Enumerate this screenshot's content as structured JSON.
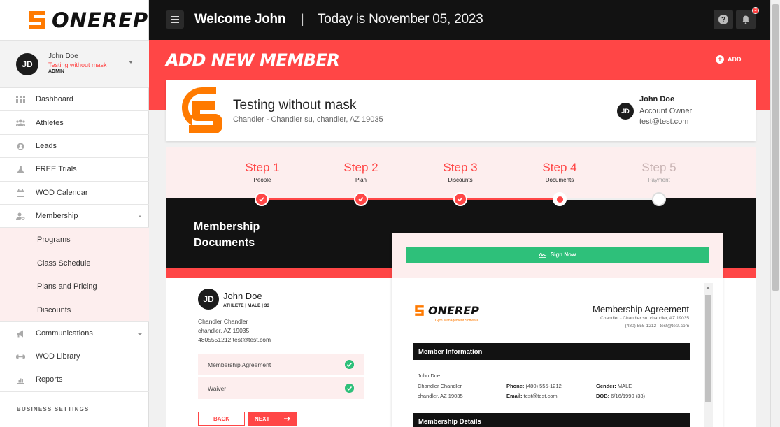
{
  "app": {
    "brand": "ONEREP"
  },
  "user": {
    "initials": "JD",
    "name": "John Doe",
    "gym": "Testing without mask",
    "role": "ADMIN"
  },
  "nav": {
    "items": [
      {
        "label": "Dashboard",
        "icon": "grid-icon"
      },
      {
        "label": "Athletes",
        "icon": "people-icon"
      },
      {
        "label": "Leads",
        "icon": "user-circle-icon"
      },
      {
        "label": "FREE Trials",
        "icon": "flask-icon"
      },
      {
        "label": "WOD Calendar",
        "icon": "calendar-icon"
      },
      {
        "label": "Membership",
        "icon": "user-gear-icon"
      }
    ],
    "sub": [
      {
        "label": "Programs"
      },
      {
        "label": "Class Schedule"
      },
      {
        "label": "Plans and Pricing"
      },
      {
        "label": "Discounts"
      }
    ],
    "items2": [
      {
        "label": "Communications",
        "icon": "megaphone-icon"
      },
      {
        "label": "WOD Library",
        "icon": "dumbbell-icon"
      },
      {
        "label": "Reports",
        "icon": "report-icon"
      }
    ],
    "section": "BUSINESS SETTINGS"
  },
  "topbar": {
    "welcome": "Welcome John",
    "separator": "|",
    "today": "Today is November 05, 2023",
    "notifications": "2"
  },
  "page": {
    "title": "ADD NEW MEMBER",
    "add_label": "ADD"
  },
  "gym": {
    "name": "Testing without mask",
    "address": "Chandler - Chandler su, chandler, AZ 19035",
    "owner_initials": "JD",
    "owner_name": "John Doe",
    "owner_role": "Account Owner",
    "owner_email": "test@test.com"
  },
  "steps": [
    {
      "title": "Step 1",
      "sub": "People",
      "state": "done"
    },
    {
      "title": "Step 2",
      "sub": "Plan",
      "state": "done"
    },
    {
      "title": "Step 3",
      "sub": "Discounts",
      "state": "done"
    },
    {
      "title": "Step 4",
      "sub": "Documents",
      "state": "current"
    },
    {
      "title": "Step 5",
      "sub": "Payment",
      "state": "pending"
    }
  ],
  "docs": {
    "title_line1": "Membership",
    "title_line2": "Documents"
  },
  "member": {
    "initials": "JD",
    "name": "John Doe",
    "meta": "ATHLETE | MALE | 33",
    "address1": "Chandler Chandler",
    "address2": "chandler, AZ 19035",
    "contact": "4805551212 test@test.com"
  },
  "documents": [
    {
      "label": "Membership Agreement",
      "status": "signed"
    },
    {
      "label": "Waiver",
      "status": "signed"
    }
  ],
  "buttons": {
    "back": "BACK",
    "next": "NEXT"
  },
  "preview": {
    "sign_label": "Sign Now",
    "logo": "ONEREP",
    "tagline": "Gym Management Software",
    "title": "Membership Agreement",
    "gym_line": "Chandler - Chandler su, chandler, AZ 19035",
    "contact_line": "(480) 555-1212 | test@test.com",
    "section1": "Member Information",
    "member_name": "John Doe",
    "member_addr1": "Chandler Chandler",
    "member_addr2": "chandler, AZ 19035",
    "phone_label": "Phone:",
    "phone": "(480) 555-1212",
    "email_label": "Email:",
    "email": "test@test.com",
    "gender_label": "Gender:",
    "gender": "MALE",
    "dob_label": "DOB:",
    "dob": "6/16/1990 (33)",
    "section2": "Membership Details"
  },
  "colors": {
    "accent": "#ff4646",
    "dark": "#121212",
    "success": "#2ec07a",
    "orange": "#ff7a00"
  }
}
